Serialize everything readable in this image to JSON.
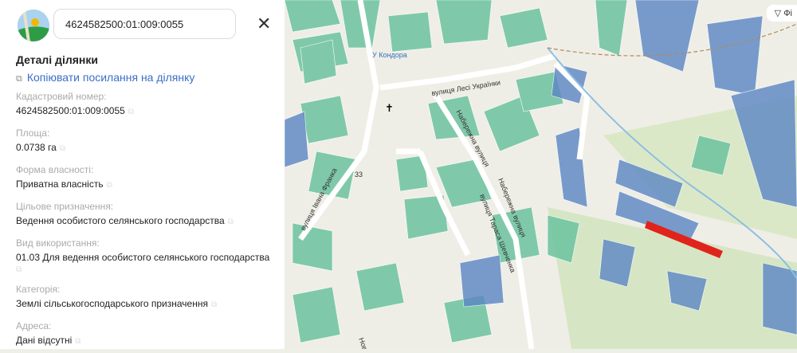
{
  "search": {
    "value": "4624582500:01:009:0055"
  },
  "panel": {
    "title": "Деталі ділянки",
    "copy_link": "Копіювати посилання на ділянку",
    "fields": [
      {
        "label": "Кадастровий номер:",
        "value": "4624582500:01:009:0055"
      },
      {
        "label": "Площа:",
        "value": "0.0738 га"
      },
      {
        "label": "Форма власності:",
        "value": "Приватна власність"
      },
      {
        "label": "Цільове призначення:",
        "value": "Ведення особистого селянського господарства"
      },
      {
        "label": "Вид використання:",
        "value": "01.03 Для ведення особистого селянського господарства"
      },
      {
        "label": "Категорія:",
        "value": "Землі сільськогосподарського призначення"
      },
      {
        "label": "Адреса:",
        "value": "Дані відсутні"
      }
    ]
  },
  "map": {
    "filter_label": "Фі",
    "streets": [
      "вулиця Лесі Українки",
      "Набережна вулиця",
      "вулиця Івана Франка",
      "вулиця Тараса Шевченка",
      "Набережна вулиця",
      "Нова в"
    ],
    "poi": [
      "У Кондора",
      "33"
    ],
    "colors": {
      "selected": "#e0241b",
      "parcel_green": "#6cc3a0",
      "parcel_blue": "#5b86c5"
    }
  }
}
